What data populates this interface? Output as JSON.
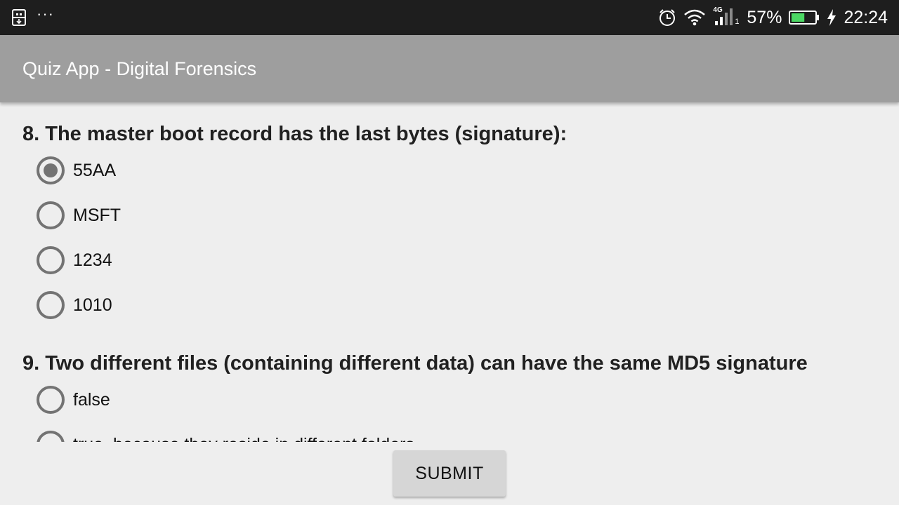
{
  "status_bar": {
    "left_icons": [
      "usb-debug-icon",
      "more-notifications-icon"
    ],
    "overflow_glyph": "···",
    "right_icons": [
      "alarm-icon",
      "wifi-icon",
      "signal-4g-icon",
      "battery-icon",
      "charging-icon"
    ],
    "network_label": "4G",
    "sim_index": "1",
    "battery_percent": "57%",
    "battery_level": 0.57,
    "battery_color": "#4cd964",
    "time": "22:24"
  },
  "app_bar": {
    "title": "Quiz App - Digital Forensics"
  },
  "questions": [
    {
      "text": "8. The master boot record has the last bytes (signature):",
      "options": [
        {
          "label": "55AA",
          "checked": true
        },
        {
          "label": "MSFT",
          "checked": false
        },
        {
          "label": "1234",
          "checked": false
        },
        {
          "label": "1010",
          "checked": false
        }
      ]
    },
    {
      "text": "9. Two different files (containing different data) can have the same MD5 signature",
      "options": [
        {
          "label": "false",
          "checked": false
        },
        {
          "label": "true, because they reside in different folders",
          "checked": false
        }
      ]
    }
  ],
  "submit": {
    "label": "SUBMIT"
  }
}
